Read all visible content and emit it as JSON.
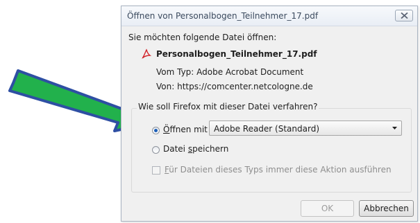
{
  "window": {
    "title": "Öffnen von Personalbogen_Teilnehmer_17.pdf",
    "close_icon": "close-icon"
  },
  "dialog": {
    "prompt": "Sie möchten folgende Datei öffnen:",
    "file_icon": "pdf-file-icon",
    "file_name": "Personalbogen_Teilnehmer_17.pdf",
    "type_text": "Vom Typ: Adobe Acrobat Document",
    "from_text": "Von: https://comcenter.netcologne.de",
    "group_title": "Wie soll Firefox mit dieser Datei verfahren?",
    "open_with": {
      "accesskey": "Ö",
      "rest": "ffnen mit",
      "checked": true
    },
    "app_select": {
      "value": "Adobe Reader  (Standard)"
    },
    "save_file": {
      "before": "Datei ",
      "accesskey": "s",
      "after": "peichern",
      "checked": false
    },
    "always": {
      "accesskey": "F",
      "rest": "ür Dateien dieses Typs immer diese Aktion ausführen",
      "checked": false,
      "disabled": true
    },
    "buttons": {
      "ok": "OK",
      "cancel": "Abbrechen"
    }
  },
  "annotation": {
    "arrow_icon": "green-pointer-arrow-icon",
    "arrow_fill": "#22b14c",
    "arrow_stroke": "#2e4fa3"
  },
  "colors": {
    "accent": "#1d5fb8",
    "pdf_red": "#d2232a"
  }
}
